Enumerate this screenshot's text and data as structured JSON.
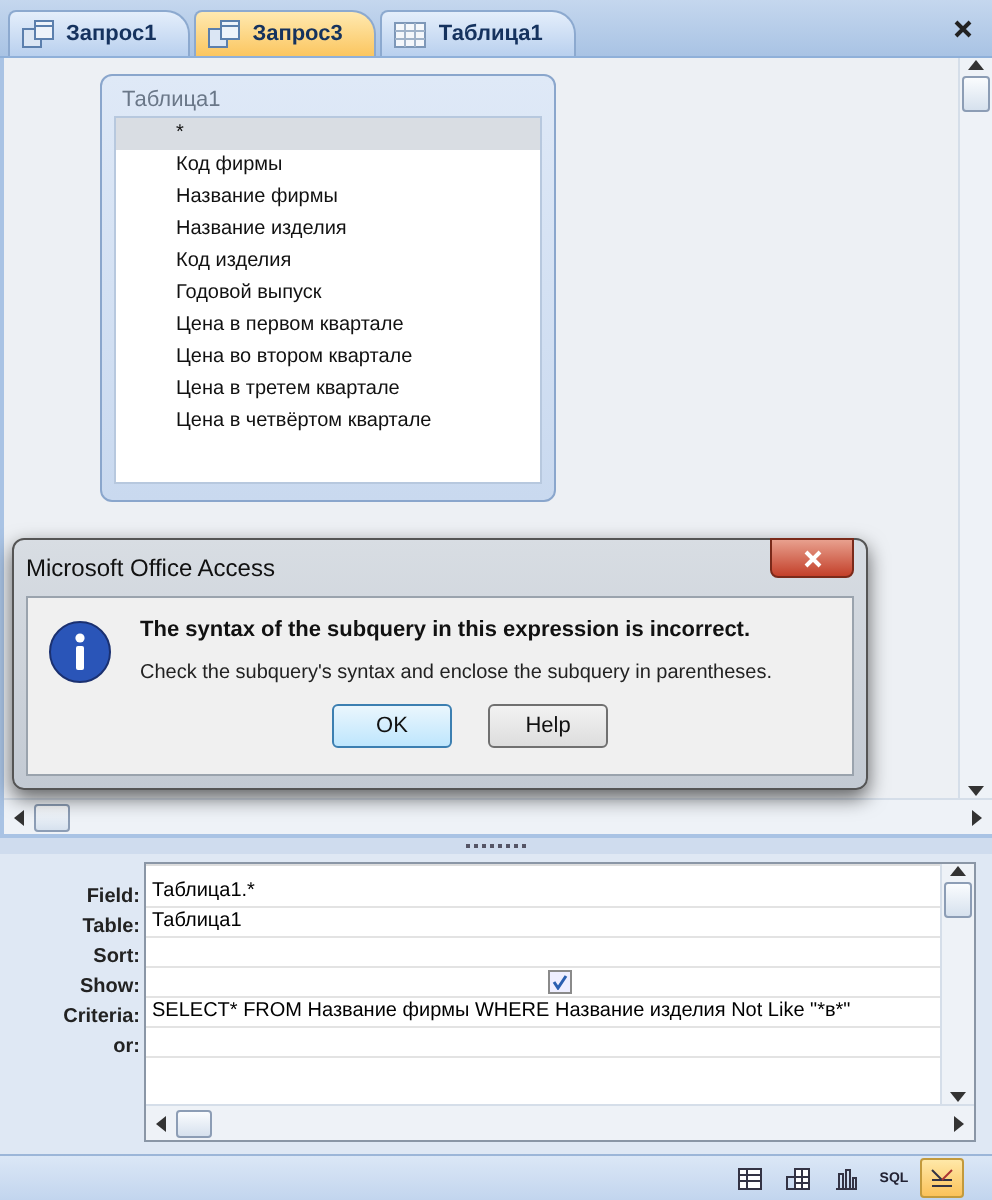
{
  "tabs": [
    {
      "label": "Запрос1",
      "kind": "query",
      "selected": false
    },
    {
      "label": "Запрос3",
      "kind": "query",
      "selected": true
    },
    {
      "label": "Таблица1",
      "kind": "table",
      "selected": false
    }
  ],
  "table_box": {
    "title": "Таблица1",
    "fields": [
      {
        "name": "*",
        "selected": true
      },
      {
        "name": "Код фирмы",
        "selected": false
      },
      {
        "name": "Название фирмы",
        "selected": false
      },
      {
        "name": "Название изделия",
        "selected": false
      },
      {
        "name": "Код изделия",
        "selected": false
      },
      {
        "name": "Годовой выпуск",
        "selected": false
      },
      {
        "name": "Цена в первом квартале",
        "selected": false
      },
      {
        "name": "Цена во втором квартале",
        "selected": false
      },
      {
        "name": "Цена в третем квартале",
        "selected": false
      },
      {
        "name": "Цена в четвёртом квартале",
        "selected": false
      }
    ]
  },
  "dialog": {
    "title": "Microsoft Office Access",
    "heading": "The syntax of the subquery in this expression is incorrect.",
    "message": "Check the subquery's syntax and enclose the subquery in parentheses.",
    "buttons": [
      {
        "label": "OK",
        "selected": true
      },
      {
        "label": "Help",
        "selected": false
      }
    ]
  },
  "grid": {
    "rows": [
      {
        "label": "Field:",
        "kind": "text",
        "value": "Таблица1.*"
      },
      {
        "label": "Table:",
        "kind": "text",
        "value": "Таблица1"
      },
      {
        "label": "Sort:",
        "kind": "text"
      },
      {
        "label": "Show:",
        "kind": "check",
        "checked": true
      },
      {
        "label": "Criteria:",
        "kind": "text",
        "value": "SELECT* FROM Название фирмы WHERE Название изделия Not Like \"*в*\""
      },
      {
        "label": "or:",
        "kind": "text"
      }
    ]
  },
  "status_bar": {
    "views": [
      {
        "kind": "datasheet",
        "selected": false
      },
      {
        "kind": "pivot-table",
        "selected": false
      },
      {
        "kind": "pivot-chart",
        "selected": false
      },
      {
        "kind": "sql",
        "label": "SQL",
        "selected": false
      },
      {
        "kind": "design",
        "selected": true
      }
    ]
  }
}
